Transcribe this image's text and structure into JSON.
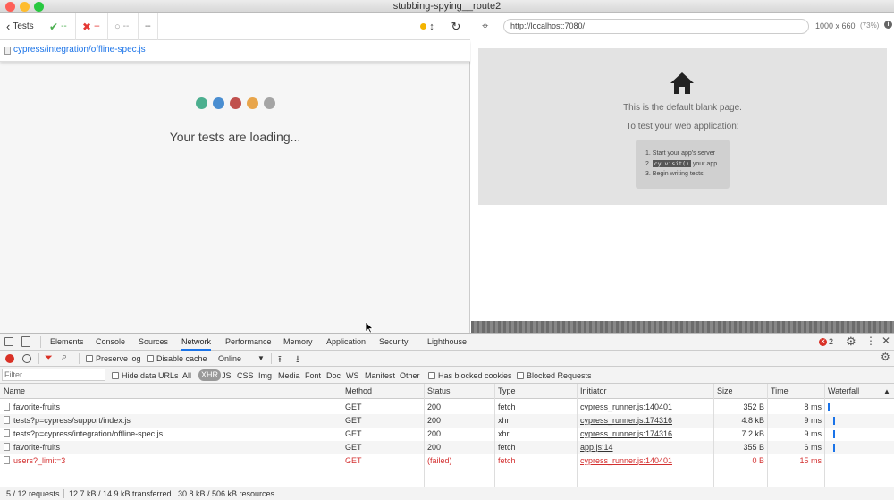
{
  "window": {
    "title": "stubbing-spying__route2"
  },
  "reporter": {
    "tests_label": "Tests",
    "passed": "--",
    "failed": "--",
    "pending": "--",
    "duration": "--",
    "spec_path": "cypress/integration/offline-spec.js",
    "loading_text": "Your tests are loading...",
    "dot_colors": [
      "#4caf8f",
      "#4a8ed1",
      "#c0504d",
      "#e8a54b",
      "#a5a5a5"
    ]
  },
  "aut": {
    "url": "http://localhost:7080/",
    "viewport": "1000 x 660",
    "zoom": "(73%)",
    "blank_line1": "This is the default blank page.",
    "blank_line2": "To test your web application:",
    "steps": [
      {
        "num": "1.",
        "text": "Start your app's server"
      },
      {
        "num": "2.",
        "code": "cy.visit()",
        "text": "your app"
      },
      {
        "num": "3.",
        "text": "Begin writing tests"
      }
    ]
  },
  "devtools": {
    "tabs": [
      "Elements",
      "Console",
      "Sources",
      "Network",
      "Performance",
      "Memory",
      "Application",
      "Security",
      "Lighthouse"
    ],
    "active_tab": "Network",
    "error_count": "2",
    "toolbar": {
      "preserve_log": "Preserve log",
      "disable_cache": "Disable cache",
      "throttle": "Online"
    },
    "filter": {
      "placeholder": "Filter",
      "hide_data_urls": "Hide data URLs",
      "types": [
        "All",
        "XHR",
        "JS",
        "CSS",
        "Img",
        "Media",
        "Font",
        "Doc",
        "WS",
        "Manifest",
        "Other"
      ],
      "active_type": "XHR",
      "has_blocked_cookies": "Has blocked cookies",
      "blocked_requests": "Blocked Requests"
    },
    "columns": [
      "Name",
      "Method",
      "Status",
      "Type",
      "Initiator",
      "Size",
      "Time",
      "Waterfall"
    ],
    "rows": [
      {
        "name": "favorite-fruits",
        "method": "GET",
        "status": "200",
        "type": "fetch",
        "initiator": "cypress_runner.js:140401",
        "size": "352 B",
        "time": "8 ms",
        "failed": false
      },
      {
        "name": "tests?p=cypress/support/index.js",
        "method": "GET",
        "status": "200",
        "type": "xhr",
        "initiator": "cypress_runner.js:174316",
        "size": "4.8 kB",
        "time": "9 ms",
        "failed": false
      },
      {
        "name": "tests?p=cypress/integration/offline-spec.js",
        "method": "GET",
        "status": "200",
        "type": "xhr",
        "initiator": "cypress_runner.js:174316",
        "size": "7.2 kB",
        "time": "9 ms",
        "failed": false
      },
      {
        "name": "favorite-fruits",
        "method": "GET",
        "status": "200",
        "type": "fetch",
        "initiator": "app.js:14",
        "size": "355 B",
        "time": "6 ms",
        "failed": false
      },
      {
        "name": "users?_limit=3",
        "method": "GET",
        "status": "(failed)",
        "type": "fetch",
        "initiator": "cypress_runner.js:140401",
        "size": "0 B",
        "time": "15 ms",
        "failed": true
      }
    ],
    "status": {
      "requests": "5 / 12 requests",
      "transferred": "12.7 kB / 14.9 kB transferred",
      "resources": "30.8 kB / 506 kB resources"
    },
    "colors": {
      "accent": "#1a73e8",
      "error": "#d32f2f"
    }
  }
}
